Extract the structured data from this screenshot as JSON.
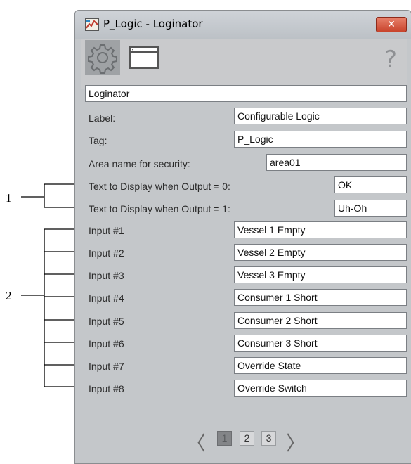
{
  "callouts": {
    "one": "1",
    "two": "2"
  },
  "window": {
    "title": "P_Logic - Loginator",
    "close_glyph": "✕"
  },
  "toolbar": {
    "help_glyph": "?"
  },
  "form": {
    "name_value": "Loginator",
    "fields": [
      {
        "label": "Label:",
        "value": "Configurable Logic"
      },
      {
        "label": "Tag:",
        "value": "P_Logic"
      },
      {
        "label": "Area name for security:",
        "value": "area01"
      },
      {
        "label": "Text to Display when Output = 0:",
        "value": "OK"
      },
      {
        "label": "Text to Display when Output = 1:",
        "value": "Uh-Oh"
      },
      {
        "label": "Input #1",
        "value": "Vessel 1 Empty"
      },
      {
        "label": "Input #2",
        "value": "Vessel 2 Empty"
      },
      {
        "label": "Input #3",
        "value": "Vessel 3 Empty"
      },
      {
        "label": "Input #4",
        "value": "Consumer 1 Short"
      },
      {
        "label": "Input #5",
        "value": "Consumer 2 Short"
      },
      {
        "label": "Input #6",
        "value": "Consumer 3 Short"
      },
      {
        "label": "Input #7",
        "value": "Override State"
      },
      {
        "label": "Input #8",
        "value": "Override Switch"
      }
    ]
  },
  "pager": {
    "prev_glyph": "〈",
    "next_glyph": "〉",
    "pages": [
      "1",
      "2",
      "3"
    ],
    "current_page": "1"
  },
  "icons": {
    "app": "logic-app-icon",
    "settings": "gear-icon",
    "window": "window-icon",
    "help": "help-icon",
    "close": "close-icon"
  }
}
